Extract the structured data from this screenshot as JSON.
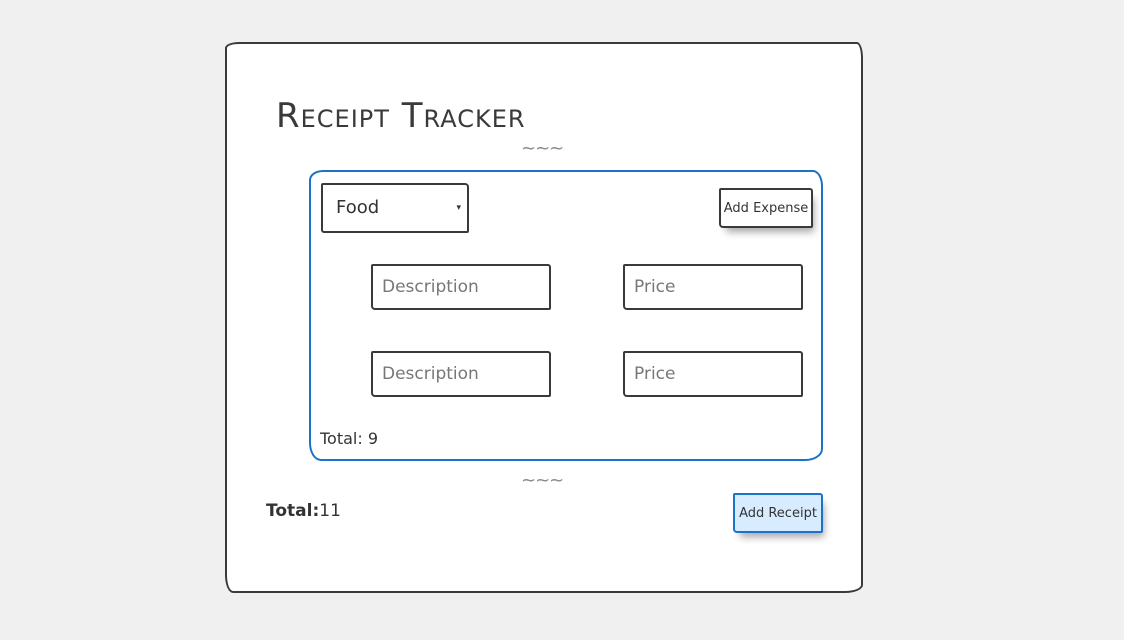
{
  "app": {
    "title": "Receipt Tracker",
    "divider_top": "~~~",
    "divider_bottom": "~~~"
  },
  "receipt": {
    "category": {
      "selected": "Food",
      "caret": "▾"
    },
    "add_expense_label": "Add Expense",
    "expenses": [
      {
        "description_value": "",
        "description_placeholder": "Description",
        "price_value": "",
        "price_placeholder": "Price"
      },
      {
        "description_value": "",
        "description_placeholder": "Description",
        "price_value": "",
        "price_placeholder": "Price"
      }
    ],
    "total_label": "Total:",
    "total_value": "9"
  },
  "footer": {
    "total_label": "Total:",
    "total_value": "11",
    "add_receipt_label": "Add Receipt"
  },
  "colors": {
    "background": "#f0f0f0",
    "card_border": "#3a3a3a",
    "accent_blue": "#1a73c9",
    "primary_button_bg": "#d8ecff"
  }
}
